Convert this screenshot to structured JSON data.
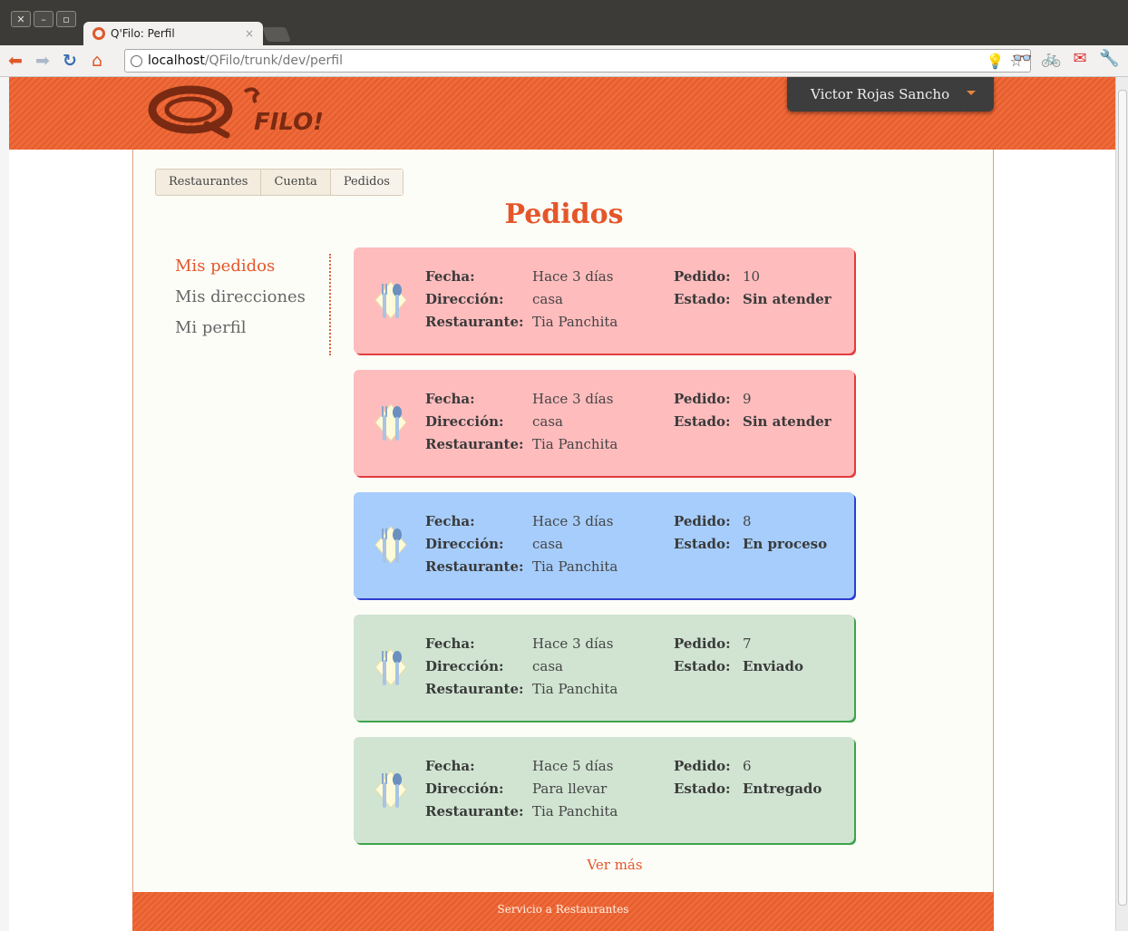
{
  "browser": {
    "tab_title": "Q'Filo: Perfil",
    "tab_close": "×",
    "url_host": "localhost",
    "url_path": "/QFilo/trunk/dev/perfil"
  },
  "header": {
    "logo_text": "FILO!",
    "user_name": "Victor Rojas Sancho"
  },
  "tabs": [
    "Restaurantes",
    "Cuenta",
    "Pedidos"
  ],
  "page_title": "Pedidos",
  "side_nav": {
    "items": [
      "Mis pedidos",
      "Mis direcciones",
      "Mi perfil"
    ],
    "active": "Mis pedidos"
  },
  "labels": {
    "fecha": "Fecha:",
    "direccion": "Dirección:",
    "restaurante": "Restaurante:",
    "pedido": "Pedido:",
    "estado": "Estado:"
  },
  "orders": [
    {
      "fecha": "Hace 3 días",
      "direccion": "casa",
      "restaurante": "Tia Panchita",
      "pedido": "10",
      "estado": "Sin atender",
      "status_color": "#ffbcbd"
    },
    {
      "fecha": "Hace 3 días",
      "direccion": "casa",
      "restaurante": "Tia Panchita",
      "pedido": "9",
      "estado": "Sin atender",
      "status_color": "#ffbcbd"
    },
    {
      "fecha": "Hace 3 días",
      "direccion": "casa",
      "restaurante": "Tia Panchita",
      "pedido": "8",
      "estado": "En proceso",
      "status_color": "#a6cdfb"
    },
    {
      "fecha": "Hace 3 días",
      "direccion": "casa",
      "restaurante": "Tia Panchita",
      "pedido": "7",
      "estado": "Enviado",
      "status_color": "#d0e4d1"
    },
    {
      "fecha": "Hace 5 días",
      "direccion": "Para llevar",
      "restaurante": "Tia Panchita",
      "pedido": "6",
      "estado": "Entregado",
      "status_color": "#d0e4d1"
    }
  ],
  "ver_mas": "Ver más",
  "footer": "Servicio a Restaurantes",
  "colors": {
    "brand": "#ef6a3a",
    "accent_text": "#e4562a",
    "user_menu": "#3d3d3d"
  }
}
